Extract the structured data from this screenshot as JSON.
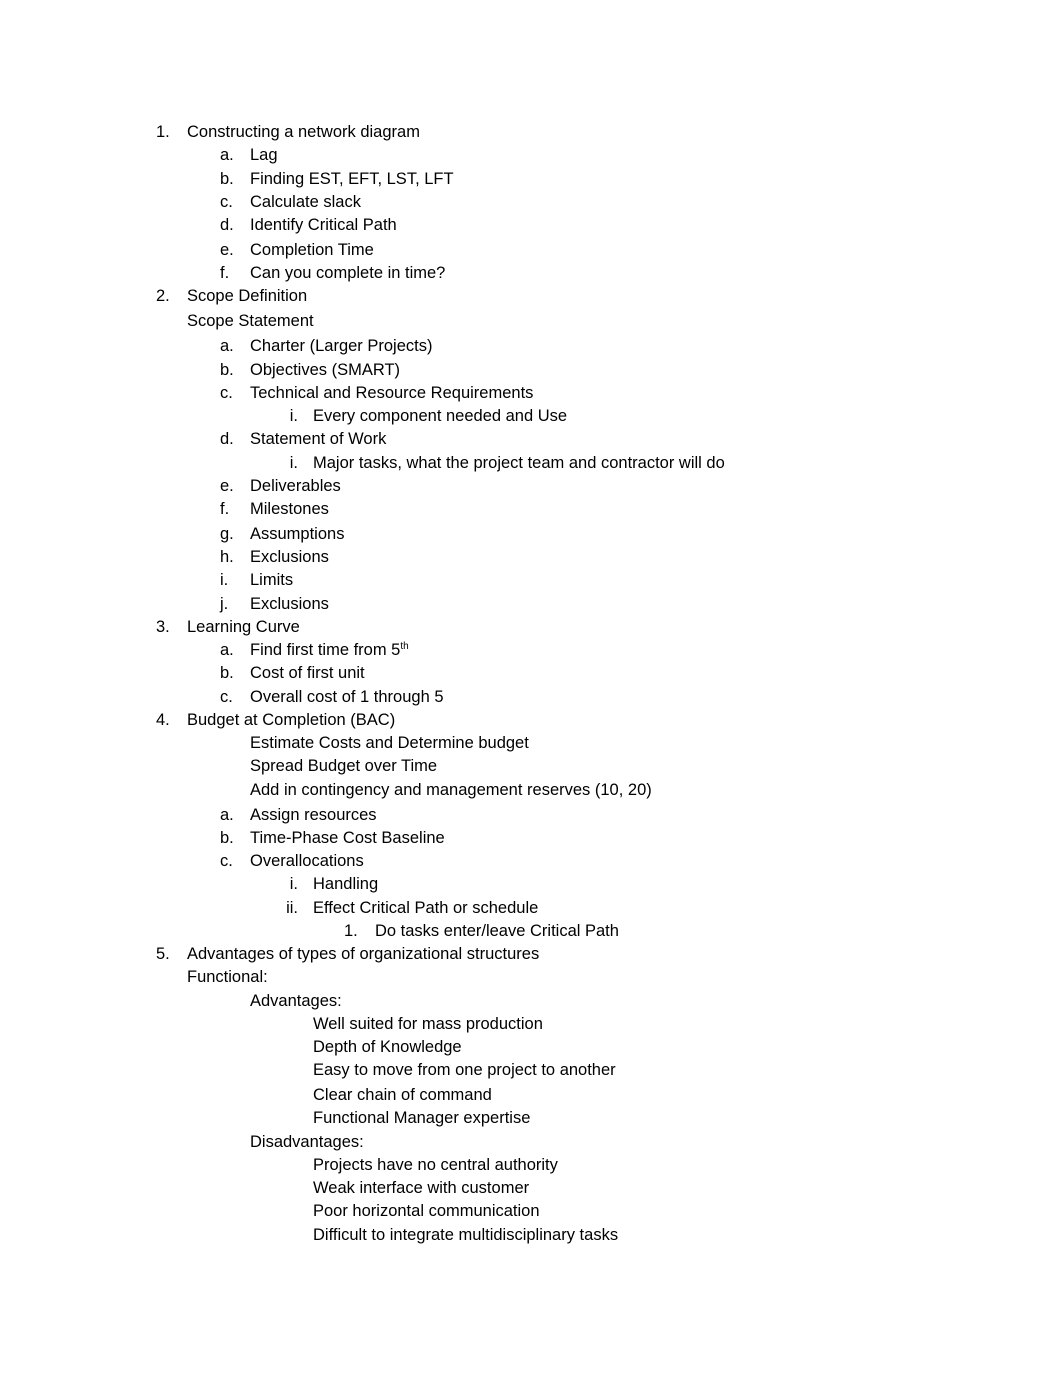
{
  "document": {
    "lines": [
      {
        "marker": "1.",
        "text": "Constructing a network diagram",
        "level": 1
      },
      {
        "marker": "a.",
        "text": "Lag",
        "level": 2
      },
      {
        "marker": "b.",
        "text": "Finding EST, EFT, LST, LFT",
        "level": 2
      },
      {
        "marker": "c.",
        "text": "Calculate slack",
        "level": 2
      },
      {
        "marker": "d.",
        "text": "Identify Critical Path",
        "level": 2
      },
      {
        "marker": "e.",
        "text": "Completion Time",
        "level": 2
      },
      {
        "marker": "f.",
        "text": "Can you complete in time?",
        "level": 2
      },
      {
        "marker": "2.",
        "text": "Scope Definition",
        "level": 1
      },
      {
        "marker": "",
        "text": "Scope Statement",
        "level": 1
      },
      {
        "marker": "a.",
        "text": "Charter (Larger Projects)",
        "level": 2
      },
      {
        "marker": "b.",
        "text": "Objectives (SMART)",
        "level": 2
      },
      {
        "marker": "c.",
        "text": "Technical and Resource Requirements",
        "level": 2
      },
      {
        "marker": "i.",
        "text": "Every component needed and Use",
        "level": 3
      },
      {
        "marker": "d.",
        "text": "Statement of Work",
        "level": 2
      },
      {
        "marker": "i.",
        "text": "Major tasks, what the project team and contractor will do",
        "level": 3
      },
      {
        "marker": "e.",
        "text": "Deliverables",
        "level": 2
      },
      {
        "marker": "f.",
        "text": "Milestones",
        "level": 2
      },
      {
        "marker": "g.",
        "text": "Assumptions",
        "level": 2
      },
      {
        "marker": "h.",
        "text": "Exclusions",
        "level": 2
      },
      {
        "marker": "i.",
        "text": "Limits",
        "level": 2
      },
      {
        "marker": "j.",
        "text": "Exclusions",
        "level": 2
      },
      {
        "marker": "3.",
        "text": "Learning Curve",
        "level": 1
      },
      {
        "marker": "a.",
        "text": "Find first time from 5",
        "sup": "th",
        "level": 2
      },
      {
        "marker": "b.",
        "text": "Cost of first unit",
        "level": 2
      },
      {
        "marker": "c.",
        "text": "Overall cost of 1 through 5",
        "level": 2
      },
      {
        "marker": "4.",
        "text": "Budget at Completion (BAC)",
        "level": 1
      },
      {
        "marker": "",
        "text": "Estimate Costs and Determine budget",
        "level": 2
      },
      {
        "marker": "",
        "text": "Spread Budget over Time",
        "level": 2
      },
      {
        "marker": "",
        "text": "Add in contingency and management reserves (10, 20)",
        "level": 2
      },
      {
        "marker": "a.",
        "text": "Assign resources",
        "level": 2
      },
      {
        "marker": "b.",
        "text": "Time-Phase Cost Baseline",
        "level": 2
      },
      {
        "marker": "c.",
        "text": "Overallocations",
        "level": 2
      },
      {
        "marker": "i.",
        "text": "Handling",
        "level": 3
      },
      {
        "marker": "ii.",
        "text": "Effect Critical Path or schedule",
        "level": 3
      },
      {
        "marker": "1.",
        "text": "Do tasks enter/leave Critical Path",
        "level": 4
      },
      {
        "marker": "5.",
        "text": "Advantages of types of organizational structures",
        "level": 1
      },
      {
        "marker": "",
        "text": "Functional:",
        "level": 1
      },
      {
        "marker": "",
        "text": "Advantages:",
        "level": 2
      },
      {
        "marker": "",
        "text": "Well suited for mass production",
        "level": 3
      },
      {
        "marker": "",
        "text": "Depth of Knowledge",
        "level": 3
      },
      {
        "marker": "",
        "text": "Easy to move from one project to another",
        "level": 3
      },
      {
        "marker": "",
        "text": "Clear chain of command",
        "level": 3
      },
      {
        "marker": "",
        "text": "Functional Manager expertise",
        "level": 3
      },
      {
        "marker": "",
        "text": "Disadvantages:",
        "level": 2
      },
      {
        "marker": "",
        "text": "Projects have no central authority",
        "level": 3
      },
      {
        "marker": "",
        "text": "Weak interface with customer",
        "level": 3
      },
      {
        "marker": "",
        "text": "Poor horizontal communication",
        "level": 3
      },
      {
        "marker": "",
        "text": "Difficult to integrate multidisciplinary tasks",
        "level": 3
      }
    ]
  }
}
